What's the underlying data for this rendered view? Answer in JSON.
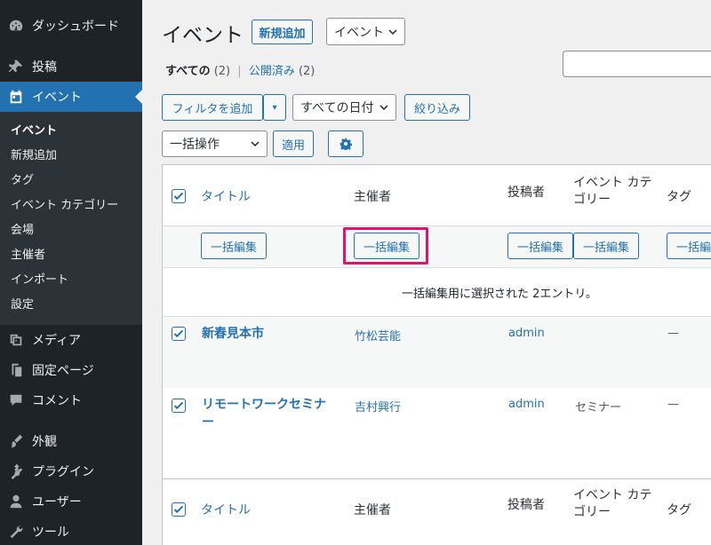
{
  "sidebar": {
    "items": [
      {
        "label": "ダッシュボード",
        "icon": "dashboard-icon"
      },
      {
        "label": "投稿",
        "icon": "pin-icon"
      },
      {
        "label": "イベント",
        "icon": "calendar-icon"
      },
      {
        "label": "メディア",
        "icon": "media-icon"
      },
      {
        "label": "固定ページ",
        "icon": "page-icon"
      },
      {
        "label": "コメント",
        "icon": "comment-icon"
      },
      {
        "label": "外観",
        "icon": "appearance-icon"
      },
      {
        "label": "プラグイン",
        "icon": "plugin-icon"
      },
      {
        "label": "ユーザー",
        "icon": "user-icon"
      },
      {
        "label": "ツール",
        "icon": "tools-icon"
      }
    ],
    "submenu": [
      "イベント",
      "新規追加",
      "タグ",
      "イベント カテゴリー",
      "会場",
      "主催者",
      "インポート",
      "設定"
    ]
  },
  "header": {
    "title": "イベント",
    "add_new": "新規追加",
    "post_type_select": "イベント"
  },
  "views": {
    "all_label": "すべての",
    "all_count": "(2)",
    "sep": "|",
    "published_label": "公開済み",
    "published_count": "(2)"
  },
  "filters": {
    "add_filter": "フィルタを追加",
    "dropdown_arrow": "▾",
    "date_select": "すべての日付",
    "filter_button": "絞り込み",
    "bulk_action_select": "一括操作",
    "apply_button": "適用"
  },
  "table": {
    "columns": [
      "タイトル",
      "主催者",
      "投稿者",
      "イベント カテ",
      "ゴリー",
      "タグ"
    ],
    "bulk_edit_label": "一括編集",
    "notice": "一括編集用に選択された 2エントリ。",
    "rows": [
      {
        "title": "新春見本市",
        "organizer": "竹松芸能",
        "author": "admin",
        "category": "",
        "tags": "—"
      },
      {
        "title_line1": "リモートワークセミナ",
        "title_line2": "ー",
        "organizer": "吉村興行",
        "author": "admin",
        "category": "セミナー",
        "tags": "—"
      }
    ]
  },
  "colors": {
    "accent": "#2271b1",
    "sidebar_bg": "#1d2327",
    "highlight": "#e0136d"
  }
}
